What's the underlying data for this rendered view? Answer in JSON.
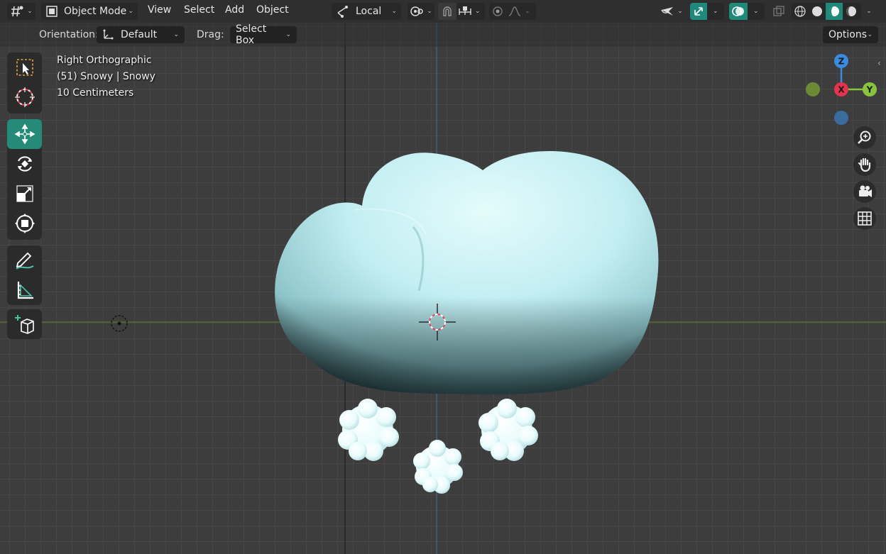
{
  "header": {
    "editor_type_icon": "viewport-grid-icon",
    "mode": {
      "label": "Object Mode",
      "icon": "object-mode-cube-icon"
    },
    "menus": [
      "View",
      "Select",
      "Add",
      "Object"
    ],
    "transform_orientation": {
      "label": "Local",
      "icon": "local-axes-icon"
    },
    "pivot_icon": "pivot-point-icon",
    "snap_icon": "magnet-icon",
    "snap_target_icon": "snap-increment-icon",
    "proportional_icon": "proportional-edit-icon",
    "falloff_icon": "falloff-curve-icon",
    "visibility_icon": "selectability-visibility-icon",
    "gizmo_icon": "gizmo-toggle-icon",
    "overlay_icon": "overlay-toggle-icon",
    "xray_icon": "xray-toggle-icon",
    "shading": {
      "wireframe_icon": "wireframe-shading-icon",
      "solid_icon": "solid-shading-icon",
      "material_icon": "material-preview-shading-icon",
      "rendered_icon": "rendered-shading-icon"
    }
  },
  "tool_settings": {
    "orientation_label": "Orientation:",
    "orientation_value": "Default",
    "drag_label": "Drag:",
    "drag_value": "Select Box",
    "options_label": "Options"
  },
  "viewport": {
    "view_name": "Right Orthographic",
    "object_info": "(51) Snowy | Snowy",
    "grid_scale": "10 Centimeters",
    "accent_colors": {
      "x_axis": "#e3344e",
      "y_axis": "#8ac43f",
      "z_axis": "#3a8ce0",
      "active_tool": "#258a78",
      "cloud": "#c9f3f6"
    }
  },
  "toolbar": {
    "tools": [
      {
        "name": "select-box",
        "icon": "select-box-icon"
      },
      {
        "name": "cursor",
        "icon": "cursor-3d-icon"
      },
      {
        "name": "move",
        "icon": "move-arrows-icon",
        "active": true
      },
      {
        "name": "rotate",
        "icon": "rotate-icon"
      },
      {
        "name": "scale",
        "icon": "scale-icon"
      },
      {
        "name": "transform",
        "icon": "transform-icon"
      },
      {
        "name": "annotate",
        "icon": "annotate-pencil-icon"
      },
      {
        "name": "measure",
        "icon": "measure-ruler-icon"
      },
      {
        "name": "add-cube",
        "icon": "add-cube-icon"
      }
    ]
  },
  "navigation_gizmo": {
    "z_label": "Z",
    "x_label": "X",
    "y_label": "Y",
    "buttons": [
      "zoom-icon",
      "pan-hand-icon",
      "camera-icon",
      "ortho-grid-icon"
    ]
  }
}
